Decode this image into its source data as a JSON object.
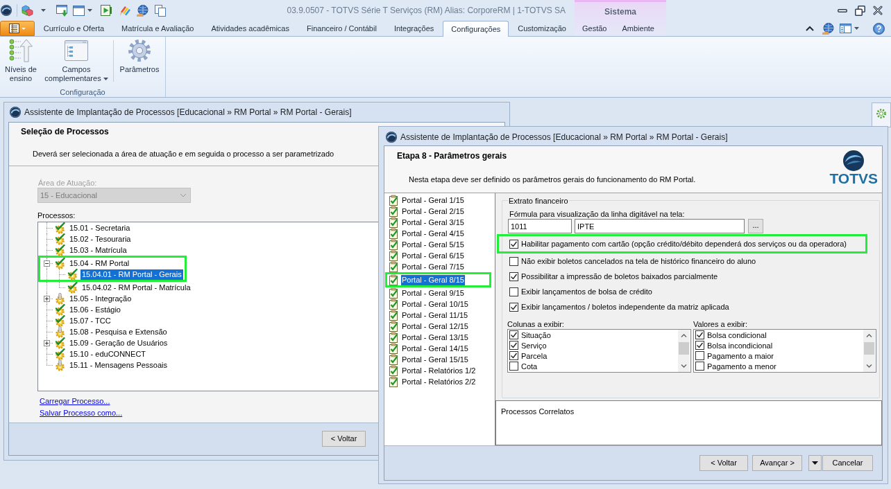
{
  "title_bar": {
    "title": "03.9.0507 - TOTVS Série T Serviços (RM) Alias: CorporeRM | 1-TOTVS SA"
  },
  "ribbon_tabs": [
    {
      "label": "Currículo e Oferta",
      "selected": false
    },
    {
      "label": "Matrícula e Avaliação",
      "selected": false
    },
    {
      "label": "Atividades acadêmicas",
      "selected": false
    },
    {
      "label": "Financeiro / Contábil",
      "selected": false
    },
    {
      "label": "Integrações",
      "selected": false
    },
    {
      "label": "Configurações",
      "selected": true
    },
    {
      "label": "Customização",
      "selected": false
    }
  ],
  "context_group": {
    "label": "Sistema",
    "tabs": [
      {
        "label": "Gestão",
        "selected": false
      },
      {
        "label": "Ambiente",
        "selected": false
      }
    ]
  },
  "ribbon": {
    "group_label": "Configuração",
    "buttons": [
      {
        "label": "Níveis de ensino",
        "dropdown": false
      },
      {
        "label": "Campos complementares",
        "dropdown": true
      },
      {
        "label": "Parâmetros",
        "dropdown": false
      }
    ]
  },
  "left_window": {
    "title": "Assistente de Implantação de Processos [Educacional » RM Portal » RM Portal - Gerais]",
    "heading": "Seleção de Processos",
    "description": "Deverá ser selecionada a área de atuação e em seguida o processo a ser parametrizado",
    "area_label": "Área de Atuação:",
    "area": {
      "value": "15 - Educacional",
      "disabled": true
    },
    "processes_label": "Processos:",
    "tree": [
      {
        "label": "15.01 - Secretaria",
        "done": true,
        "selected": false,
        "highlighted": false
      },
      {
        "label": "15.02 - Tesouraria",
        "done": true,
        "selected": false,
        "highlighted": false
      },
      {
        "label": "15.03 - Matrícula",
        "done": true,
        "selected": false,
        "highlighted": false
      },
      {
        "label": "15.04 - RM Portal",
        "done": true,
        "selected": false,
        "highlighted": true,
        "expanded": true,
        "children": [
          {
            "label": "15.04.01 - RM Portal - Gerais",
            "done": true,
            "selected": true,
            "highlighted": true
          },
          {
            "label": "15.04.02 - RM Portal - Matrícula",
            "done": true,
            "selected": false,
            "highlighted": false
          }
        ]
      },
      {
        "label": "15.05 - Integração",
        "done": false,
        "selected": false,
        "highlighted": false,
        "expanded": false
      },
      {
        "label": "15.06 - Estágio",
        "done": true,
        "selected": false,
        "highlighted": false
      },
      {
        "label": "15.07 - TCC",
        "done": true,
        "selected": false,
        "highlighted": false
      },
      {
        "label": "15.08 - Pesquisa e Extensão",
        "done": false,
        "selected": false,
        "highlighted": false
      },
      {
        "label": "15.09 - Geração de Usuários",
        "done": true,
        "selected": false,
        "highlighted": false,
        "expanded": false
      },
      {
        "label": "15.10 - eduCONNECT",
        "done": true,
        "selected": false,
        "highlighted": false
      },
      {
        "label": "15.11 - Mensagens Pessoais",
        "done": false,
        "selected": false,
        "highlighted": false
      }
    ],
    "links": [
      "Carregar Processo...",
      "Salvar Processo como..."
    ],
    "buttons": [
      "< Voltar"
    ]
  },
  "right_window": {
    "title": "Assistente de Implantação de Processos [Educacional » RM Portal » RM Portal - Gerais]",
    "heading": "Etapa 8 - Parâmetros gerais",
    "description": "Nesta etapa deve ser definido os parâmetros gerais do funcionamento do RM Portal.",
    "logo_text": "TOTVS",
    "steps": [
      {
        "label": "Portal - Geral 1/15",
        "selected": false,
        "highlighted": false
      },
      {
        "label": "Portal - Geral 2/15",
        "selected": false,
        "highlighted": false
      },
      {
        "label": "Portal - Geral 3/15",
        "selected": false,
        "highlighted": false
      },
      {
        "label": "Portal - Geral 4/15",
        "selected": false,
        "highlighted": false
      },
      {
        "label": "Portal - Geral 5/15",
        "selected": false,
        "highlighted": false
      },
      {
        "label": "Portal - Geral 6/15",
        "selected": false,
        "highlighted": false
      },
      {
        "label": "Portal - Geral 7/15",
        "selected": false,
        "highlighted": false
      },
      {
        "label": "Portal - Geral 8/15",
        "selected": true,
        "highlighted": true
      },
      {
        "label": "Portal - Geral 9/15",
        "selected": false,
        "highlighted": false
      },
      {
        "label": "Portal - Geral 10/15",
        "selected": false,
        "highlighted": false
      },
      {
        "label": "Portal - Geral 11/15",
        "selected": false,
        "highlighted": false
      },
      {
        "label": "Portal - Geral 12/15",
        "selected": false,
        "highlighted": false
      },
      {
        "label": "Portal - Geral 13/15",
        "selected": false,
        "highlighted": false
      },
      {
        "label": "Portal - Geral 14/15",
        "selected": false,
        "highlighted": false
      },
      {
        "label": "Portal - Geral 15/15",
        "selected": false,
        "highlighted": false
      },
      {
        "label": "Portal - Relatórios 1/2",
        "selected": false,
        "highlighted": false
      },
      {
        "label": "Portal - Relatórios 2/2",
        "selected": false,
        "highlighted": false
      }
    ],
    "group_title": "Extrato financeiro",
    "formula_label": "Fórmula para visualização da linha digitável na tela:",
    "formula_code": "1011",
    "formula_name": "IPTE",
    "formula_button": "...",
    "options": [
      {
        "label": "Habilitar pagamento com cartão (opção crédito/débito dependerá dos serviços ou da operadora)",
        "checked": true,
        "highlighted": true
      },
      {
        "label": "Não exibir boletos cancelados na tela de histórico financeiro do aluno",
        "checked": false,
        "highlighted": false
      },
      {
        "label": "Possibilitar a impressão de boletos baixados parcialmente",
        "checked": true,
        "highlighted": false
      },
      {
        "label": "Exibir lançamentos de bolsa de crédito",
        "checked": false,
        "highlighted": false
      },
      {
        "label": "Exibir lançamentos / boletos independente da matriz aplicada",
        "checked": true,
        "highlighted": false
      }
    ],
    "columns_label": "Colunas a exibir:",
    "columns": [
      {
        "label": "Situação",
        "checked": true
      },
      {
        "label": "Serviço",
        "checked": true
      },
      {
        "label": "Parcela",
        "checked": true
      },
      {
        "label": "Cota",
        "checked": false
      }
    ],
    "values_label": "Valores a exibir:",
    "values": [
      {
        "label": "Bolsa condicional",
        "checked": true
      },
      {
        "label": "Bolsa incondicional",
        "checked": true
      },
      {
        "label": "Pagamento a maior",
        "checked": false
      },
      {
        "label": "Pagamento a menor",
        "checked": false
      }
    ],
    "related_title": "Processos Correlatos",
    "buttons": [
      {
        "label": "< Voltar",
        "menu": false
      },
      {
        "label": "Avançar >",
        "menu": false
      },
      {
        "label": "Cancelar",
        "menu": true
      }
    ]
  }
}
